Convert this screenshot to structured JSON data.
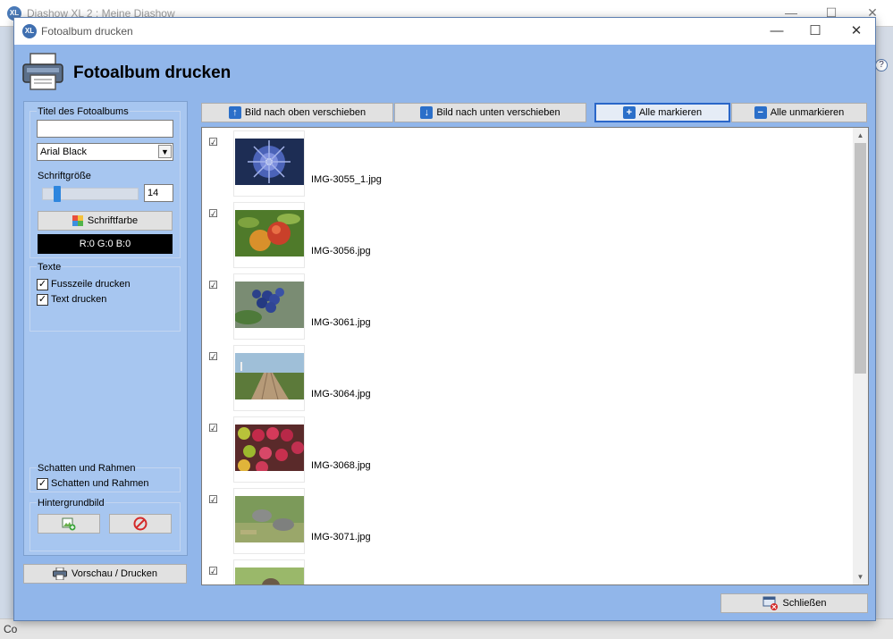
{
  "background_app": {
    "title": "Diashow XL 2 : Meine Diashow",
    "logo": "XL",
    "status_text": "Co",
    "help_glyph": "?"
  },
  "dialog": {
    "logo": "XL",
    "title": "Fotoalbum drucken",
    "controls": {
      "minimize": "—",
      "maximize": "☐",
      "close": "✕"
    },
    "header_title": "Fotoalbum drucken"
  },
  "left_panel": {
    "album_title_label": "Titel des Fotoalbums",
    "album_title_value": "",
    "font_select": "Arial Black",
    "font_size_label": "Schriftgröße",
    "font_size_value": "14",
    "font_color_button": "Schriftfarbe",
    "color_display": "R:0 G:0 B:0",
    "texts_group": "Texte",
    "print_footer": {
      "label": "Fusszeile drucken",
      "checked": true
    },
    "print_text": {
      "label": "Text drucken",
      "checked": true
    },
    "shadow_group": "Schatten und Rahmen",
    "shadow_frame": {
      "label": "Schatten und Rahmen",
      "checked": true
    },
    "background_group": "Hintergrundbild"
  },
  "preview_button": "Vorschau / Drucken",
  "toolbar": {
    "move_up": "Bild nach oben verschieben",
    "move_down": "Bild nach unten verschieben",
    "select_all": "Alle markieren",
    "deselect_all": "Alle unmarkieren"
  },
  "images": [
    {
      "file": "IMG-3055_1.jpg",
      "checked": true,
      "thumb": "blue-flower"
    },
    {
      "file": "IMG-3056.jpg",
      "checked": true,
      "thumb": "apples"
    },
    {
      "file": "IMG-3061.jpg",
      "checked": true,
      "thumb": "blueberries"
    },
    {
      "file": "IMG-3064.jpg",
      "checked": true,
      "thumb": "boardwalk"
    },
    {
      "file": "IMG-3068.jpg",
      "checked": true,
      "thumb": "fruit-market"
    },
    {
      "file": "IMG-3071.jpg",
      "checked": true,
      "thumb": "rhinos"
    },
    {
      "file": "",
      "checked": true,
      "thumb": "bird"
    }
  ],
  "close_button": "Schließen",
  "colors": {
    "dialog_bg": "#91b6ea",
    "panel_bg": "#a7c6f0",
    "accent": "#2b6fc9"
  }
}
